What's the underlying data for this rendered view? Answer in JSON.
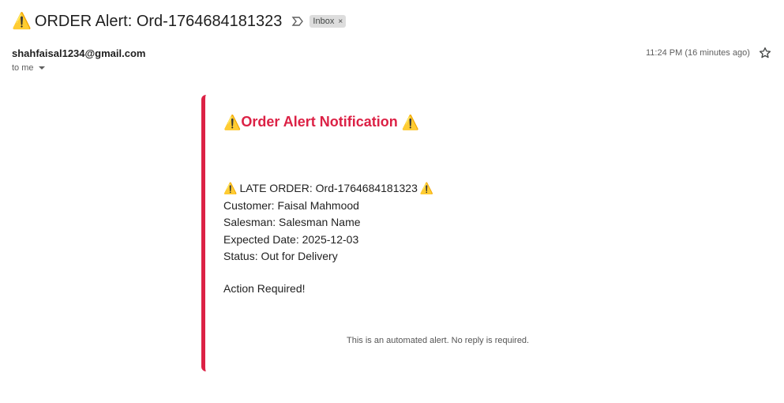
{
  "email": {
    "subject_icon": "⚠️",
    "subject": "ORDER Alert: Ord-1764684181323",
    "label": "Inbox",
    "label_close": "×",
    "sender": "shahfaisal1234@gmail.com",
    "recipient": "to me",
    "time": "11:24 PM (16 minutes ago)"
  },
  "body": {
    "title_prefix": "⚠️",
    "title": "Order Alert Notification",
    "title_suffix": "⚠️",
    "late_prefix": "⚠️",
    "late_text": "LATE ORDER: Ord-1764684181323",
    "late_suffix": "⚠️",
    "customer": "Customer: Faisal Mahmood",
    "salesman": "Salesman: Salesman Name",
    "expected": "Expected Date: 2025-12-03",
    "status": "Status: Out for Delivery",
    "action": "Action Required!",
    "footer": "This is an automated alert. No reply is required."
  },
  "colors": {
    "accent": "#dc2145"
  }
}
